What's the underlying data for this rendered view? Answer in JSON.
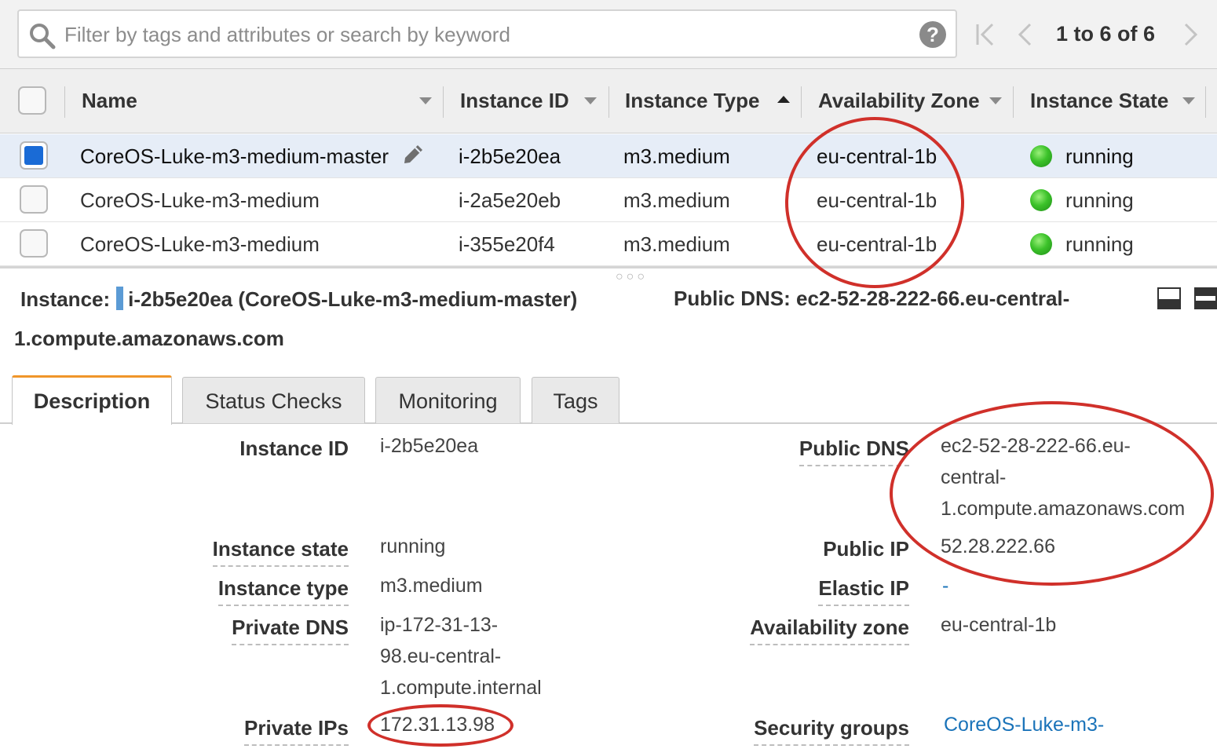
{
  "search": {
    "placeholder": "Filter by tags and attributes or search by keyword",
    "value": ""
  },
  "pagination": {
    "text": "1 to 6 of 6"
  },
  "columns": {
    "name": "Name",
    "instance_id": "Instance ID",
    "instance_type": "Instance Type",
    "availability_zone": "Availability Zone",
    "instance_state": "Instance State"
  },
  "rows": [
    {
      "name": "CoreOS-Luke-m3-medium-master",
      "instance_id": "i-2b5e20ea",
      "instance_type": "m3.medium",
      "availability_zone": "eu-central-1b",
      "instance_state": "running",
      "selected": true
    },
    {
      "name": "CoreOS-Luke-m3-medium",
      "instance_id": "i-2a5e20eb",
      "instance_type": "m3.medium",
      "availability_zone": "eu-central-1b",
      "instance_state": "running",
      "selected": false
    },
    {
      "name": "CoreOS-Luke-m3-medium",
      "instance_id": "i-355e20f4",
      "instance_type": "m3.medium",
      "availability_zone": "eu-central-1b",
      "instance_state": "running",
      "selected": false
    }
  ],
  "summary": {
    "instance_label": "Instance:",
    "instance_value": "i-2b5e20ea (CoreOS-Luke-m3-medium-master)",
    "dns_line1": "Public DNS: ec2-52-28-222-66.eu-central-",
    "dns_line2": "1.compute.amazonaws.com"
  },
  "tabs": {
    "description": "Description",
    "status_checks": "Status Checks",
    "monitoring": "Monitoring",
    "tags": "Tags"
  },
  "details": {
    "instance_id": {
      "label": "Instance ID",
      "value": "i-2b5e20ea"
    },
    "instance_state": {
      "label": "Instance state",
      "value": "running"
    },
    "instance_type": {
      "label": "Instance type",
      "value": "m3.medium"
    },
    "private_dns": {
      "label": "Private DNS",
      "line1": "ip-172-31-13-",
      "line2": "98.eu-central-",
      "line3": "1.compute.internal"
    },
    "private_ips": {
      "label": "Private IPs",
      "value": "172.31.13.98"
    },
    "public_dns": {
      "label": "Public DNS",
      "line1": "ec2-52-28-222-66.eu-",
      "line2": "central-",
      "line3": "1.compute.amazonaws.com"
    },
    "public_ip": {
      "label": "Public IP",
      "value": "52.28.222.66"
    },
    "elastic_ip": {
      "label": "Elastic IP",
      "value": "-"
    },
    "availability_zone": {
      "label": "Availability zone",
      "value": "eu-central-1b"
    },
    "security_groups": {
      "label": "Security groups",
      "value": "CoreOS-Luke-m3-"
    }
  },
  "colors": {
    "selected_row": "#e6edf7",
    "checkbox_checked": "#1a6bd6",
    "running_status": "#3cc22a",
    "active_tab_accent": "#f0962a",
    "link": "#1a73b9",
    "annotation": "#d0302a"
  },
  "icons": {
    "search": "search-icon",
    "help": "help-icon",
    "first_page": "first-page-icon",
    "prev_page": "prev-page-icon",
    "next_page": "next-page-icon",
    "edit": "pencil-icon",
    "status": "status-dot-icon",
    "panel_bottom": "panel-bottom-icon",
    "panel_top": "panel-top-icon"
  }
}
